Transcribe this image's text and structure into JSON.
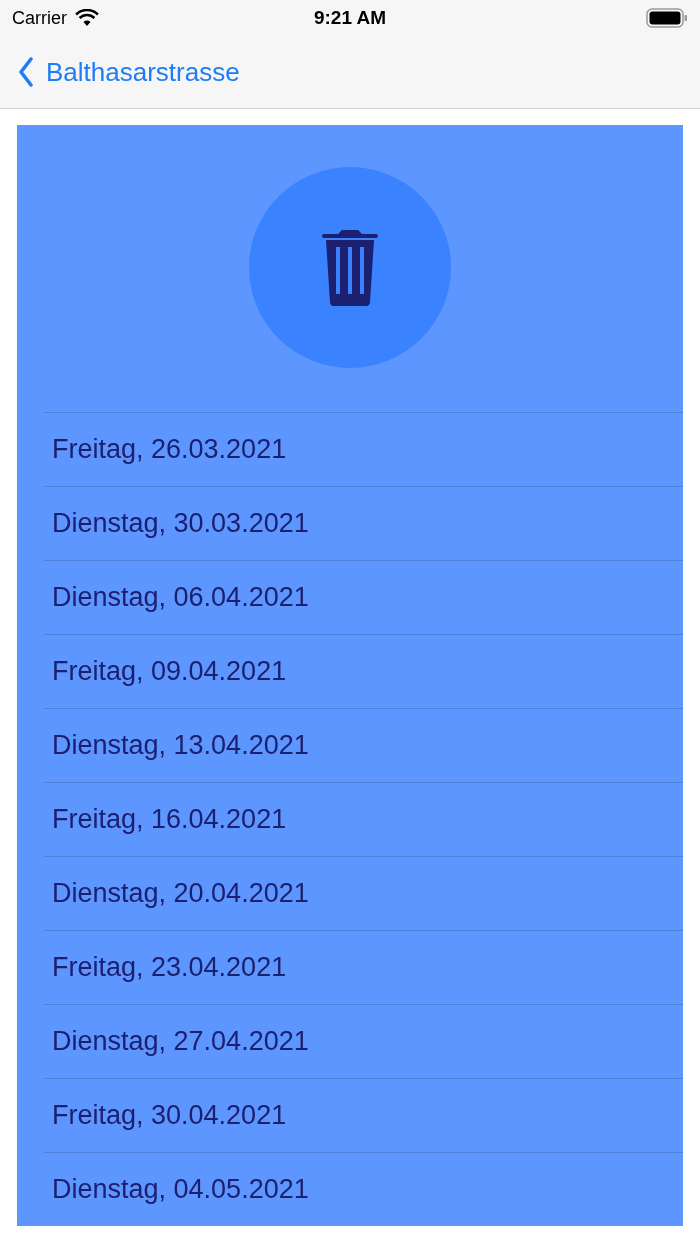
{
  "status_bar": {
    "carrier": "Carrier",
    "time": "9:21 AM"
  },
  "nav": {
    "back_label": "Balthasarstrasse"
  },
  "dates": [
    "Freitag, 26.03.2021",
    "Dienstag, 30.03.2021",
    "Dienstag, 06.04.2021",
    "Freitag, 09.04.2021",
    "Dienstag, 13.04.2021",
    "Freitag, 16.04.2021",
    "Dienstag, 20.04.2021",
    "Freitag, 23.04.2021",
    "Dienstag, 27.04.2021",
    "Freitag, 30.04.2021",
    "Dienstag, 04.05.2021"
  ]
}
